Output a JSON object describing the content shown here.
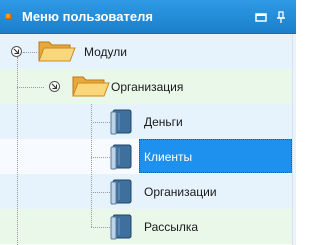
{
  "panel": {
    "title": "Меню пользователя",
    "buttons": [
      {
        "icon": "restore-window-icon"
      },
      {
        "icon": "pin-icon"
      }
    ]
  },
  "tree": {
    "nodes": [
      {
        "label": "Модули",
        "icon": "folder-open-icon",
        "expanded": true,
        "selected": false
      },
      {
        "label": "Организация",
        "icon": "folder-open-icon",
        "expanded": true,
        "selected": false
      },
      {
        "label": "Деньги",
        "icon": "book-icon",
        "selected": false
      },
      {
        "label": "Клиенты",
        "icon": "book-icon",
        "selected": true
      },
      {
        "label": "Организации",
        "icon": "book-icon",
        "selected": false
      },
      {
        "label": "Рассылка",
        "icon": "book-icon",
        "selected": false
      }
    ]
  },
  "colors": {
    "header": "#1b7fcc",
    "selection": "#1e90ee",
    "row_blue": "#e6f2fc",
    "row_green": "#e9f8e9"
  }
}
